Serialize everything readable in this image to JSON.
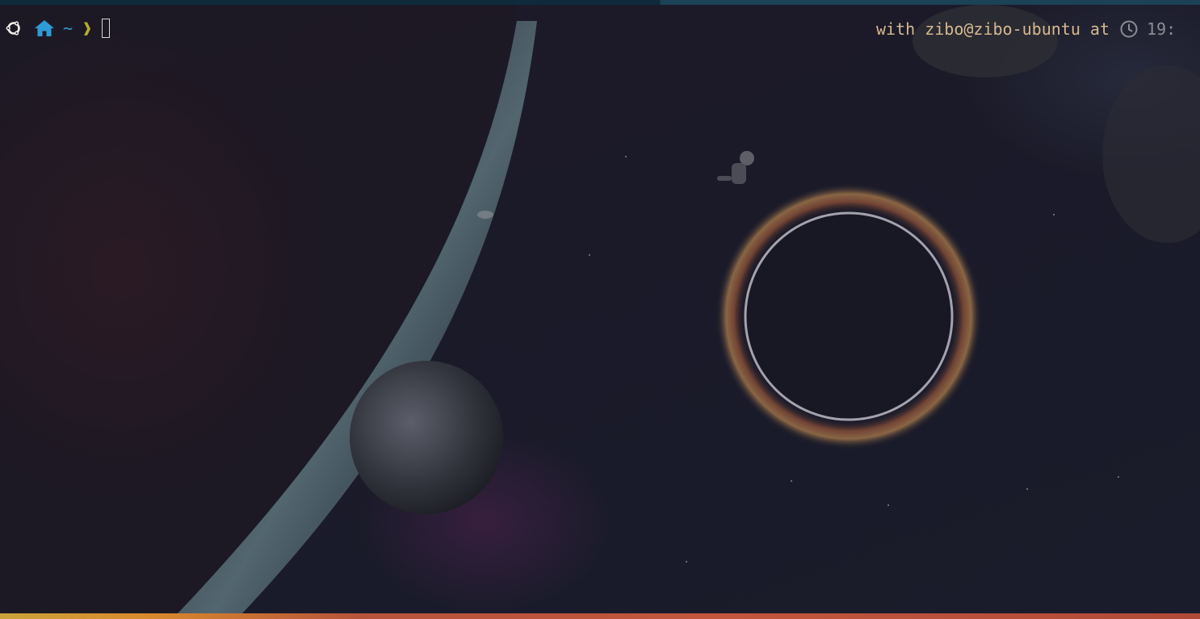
{
  "terminal": {
    "prompt": {
      "os_icon": "ubuntu-icon",
      "home_icon": "home-icon",
      "directory": "~",
      "symbol": "❱"
    },
    "right_prompt": {
      "with_label": "with",
      "user_host": "zibo@zibo-ubuntu",
      "at_label": "at",
      "clock_icon": "clock-icon",
      "time": "19:"
    }
  },
  "colors": {
    "directory": "#2e9bd6",
    "symbol": "#b2b02a",
    "right_prompt_text": "#d6b98e",
    "time_text": "#8c8d93"
  }
}
